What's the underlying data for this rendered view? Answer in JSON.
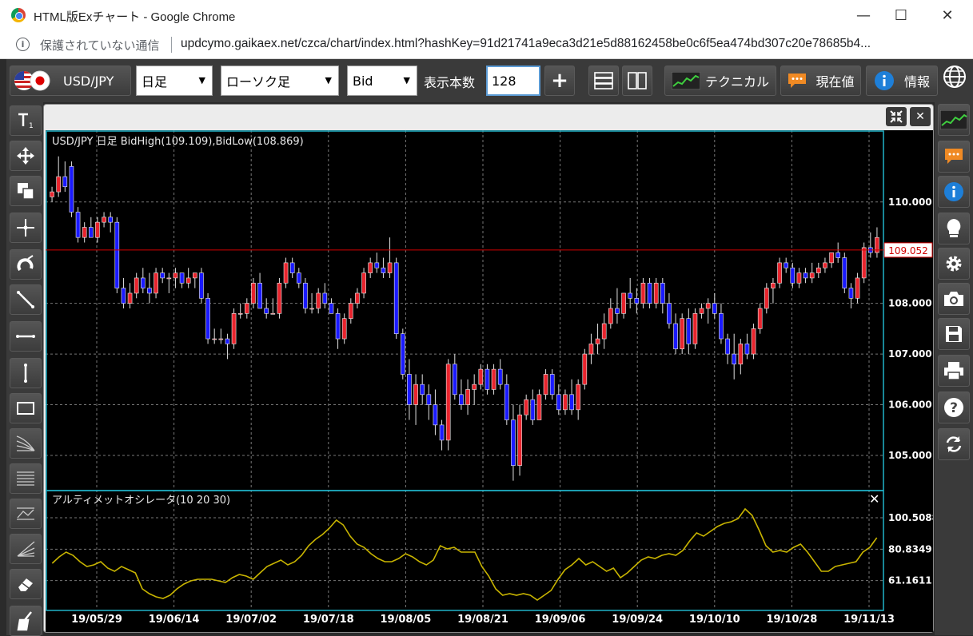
{
  "window": {
    "title": "HTML版Exチャート - Google Chrome",
    "minimize": "—",
    "maximize": "☐",
    "close": "✕"
  },
  "address": {
    "security": "保護されていない通信",
    "url": "updcymo.gaikaex.net/czca/chart/index.html?hashKey=91d21741a9eca3d21e5d88162458be0c6f5ea474bd307c20e78685b4..."
  },
  "toolbar": {
    "pair": "USD/JPY",
    "period": "日足",
    "chart_type": "ローソク足",
    "price_type": "Bid",
    "count_label": "表示本数",
    "count_value": "128",
    "plus": "+",
    "technical": "テクニカル",
    "current": "現在値",
    "info": "情報"
  },
  "colors": {
    "up": "#e8242d",
    "down": "#1a1aff",
    "oscillator": "#c8b400",
    "price_line": "#d00000",
    "frame": "#20b2c8"
  },
  "chart_data": [
    {
      "type": "candlestick",
      "title": "USD/JPY 日足  BidHigh(109.109),BidLow(108.869)",
      "current_price": "109.052",
      "current_value": 109.052,
      "yticks": [
        "110.000",
        "108.000",
        "107.000",
        "106.000",
        "105.000"
      ],
      "ytick_values": [
        110,
        108,
        107,
        106,
        105
      ],
      "ylim": [
        104.4,
        111.1
      ],
      "xticks": [
        "19/05/29",
        "19/06/14",
        "19/07/02",
        "19/07/18",
        "19/08/05",
        "19/08/21",
        "19/09/06",
        "19/09/24",
        "19/10/10",
        "19/10/28",
        "19/11/13"
      ],
      "grid": true,
      "ohlc": [
        [
          110.1,
          110.3,
          110.0,
          110.2
        ],
        [
          110.2,
          110.9,
          110.1,
          110.5
        ],
        [
          110.5,
          110.8,
          110.2,
          110.3
        ],
        [
          110.7,
          110.8,
          109.7,
          109.8
        ],
        [
          109.8,
          109.9,
          109.2,
          109.3
        ],
        [
          109.3,
          109.6,
          109.2,
          109.5
        ],
        [
          109.5,
          109.7,
          109.3,
          109.3
        ],
        [
          109.3,
          109.7,
          109.2,
          109.6
        ],
        [
          109.6,
          109.8,
          109.5,
          109.7
        ],
        [
          109.7,
          109.8,
          109.4,
          109.6
        ],
        [
          109.6,
          109.7,
          108.2,
          108.3
        ],
        [
          108.3,
          108.5,
          107.9,
          108.0
        ],
        [
          108.0,
          108.4,
          107.9,
          108.2
        ],
        [
          108.2,
          108.6,
          108.1,
          108.5
        ],
        [
          108.5,
          108.7,
          108.2,
          108.3
        ],
        [
          108.3,
          108.6,
          108.0,
          108.2
        ],
        [
          108.2,
          108.7,
          108.1,
          108.6
        ],
        [
          108.6,
          108.7,
          108.4,
          108.5
        ],
        [
          108.5,
          108.6,
          108.2,
          108.5
        ],
        [
          108.5,
          108.7,
          108.3,
          108.6
        ],
        [
          108.6,
          108.6,
          108.3,
          108.4
        ],
        [
          108.4,
          108.7,
          108.3,
          108.5
        ],
        [
          108.5,
          108.6,
          108.3,
          108.6
        ],
        [
          108.6,
          108.7,
          108.0,
          108.1
        ],
        [
          108.1,
          108.2,
          107.2,
          107.3
        ],
        [
          107.3,
          107.5,
          107.2,
          107.3
        ],
        [
          107.3,
          107.5,
          107.2,
          107.3
        ],
        [
          107.3,
          107.4,
          106.9,
          107.2
        ],
        [
          107.2,
          107.9,
          107.1,
          107.8
        ],
        [
          107.8,
          108.0,
          107.7,
          107.8
        ],
        [
          107.8,
          108.1,
          107.7,
          108.0
        ],
        [
          108.0,
          108.5,
          107.9,
          108.4
        ],
        [
          108.4,
          108.6,
          107.9,
          107.9
        ],
        [
          107.9,
          108.1,
          107.7,
          107.8
        ],
        [
          107.8,
          108.1,
          107.8,
          107.8
        ],
        [
          107.8,
          108.5,
          107.7,
          108.4
        ],
        [
          108.4,
          108.9,
          108.3,
          108.8
        ],
        [
          108.8,
          108.9,
          108.5,
          108.6
        ],
        [
          108.6,
          108.7,
          108.3,
          108.4
        ],
        [
          108.4,
          108.5,
          107.8,
          107.9
        ],
        [
          107.9,
          108.2,
          107.8,
          107.9
        ],
        [
          107.9,
          108.3,
          107.8,
          108.2
        ],
        [
          108.2,
          108.4,
          107.9,
          108.0
        ],
        [
          108.0,
          108.1,
          107.8,
          107.8
        ],
        [
          107.8,
          107.9,
          107.1,
          107.3
        ],
        [
          107.3,
          107.8,
          107.2,
          107.7
        ],
        [
          107.7,
          108.1,
          107.6,
          108.0
        ],
        [
          108.0,
          108.3,
          107.9,
          108.2
        ],
        [
          108.2,
          108.7,
          108.1,
          108.6
        ],
        [
          108.6,
          108.9,
          108.5,
          108.8
        ],
        [
          108.8,
          109.0,
          108.6,
          108.7
        ],
        [
          108.7,
          108.9,
          108.5,
          108.6
        ],
        [
          108.6,
          109.3,
          108.5,
          108.8
        ],
        [
          108.8,
          108.9,
          107.3,
          107.4
        ],
        [
          107.4,
          107.5,
          106.5,
          106.6
        ],
        [
          106.6,
          106.9,
          105.7,
          106.0
        ],
        [
          106.0,
          106.6,
          105.6,
          106.4
        ],
        [
          106.4,
          106.6,
          106.0,
          106.2
        ],
        [
          106.2,
          106.4,
          105.7,
          106.0
        ],
        [
          106.0,
          106.3,
          105.4,
          105.6
        ],
        [
          105.6,
          105.7,
          105.1,
          105.3
        ],
        [
          105.3,
          106.9,
          105.1,
          106.8
        ],
        [
          106.8,
          107.0,
          106.1,
          106.2
        ],
        [
          106.2,
          106.5,
          105.9,
          106.0
        ],
        [
          106.0,
          106.5,
          105.8,
          106.3
        ],
        [
          106.3,
          106.6,
          106.0,
          106.4
        ],
        [
          106.4,
          106.8,
          106.3,
          106.7
        ],
        [
          106.7,
          106.8,
          106.2,
          106.3
        ],
        [
          106.3,
          106.8,
          106.2,
          106.7
        ],
        [
          106.7,
          106.9,
          106.3,
          106.4
        ],
        [
          106.4,
          106.6,
          105.6,
          105.7
        ],
        [
          105.7,
          106.0,
          104.5,
          104.8
        ],
        [
          104.8,
          106.0,
          104.6,
          105.8
        ],
        [
          105.8,
          106.2,
          105.7,
          106.1
        ],
        [
          106.1,
          106.3,
          105.6,
          105.7
        ],
        [
          105.7,
          106.3,
          105.7,
          106.2
        ],
        [
          106.2,
          106.7,
          106.1,
          106.6
        ],
        [
          106.6,
          106.7,
          106.1,
          106.2
        ],
        [
          106.2,
          106.4,
          105.8,
          105.9
        ],
        [
          105.9,
          106.3,
          105.8,
          106.2
        ],
        [
          106.2,
          106.5,
          105.8,
          105.9
        ],
        [
          105.9,
          106.5,
          105.7,
          106.4
        ],
        [
          106.4,
          107.1,
          106.3,
          107.0
        ],
        [
          107.0,
          107.4,
          106.8,
          107.2
        ],
        [
          107.2,
          107.6,
          107.0,
          107.3
        ],
        [
          107.3,
          107.8,
          107.1,
          107.6
        ],
        [
          107.6,
          108.1,
          107.5,
          107.9
        ],
        [
          107.9,
          108.3,
          107.6,
          107.8
        ],
        [
          107.8,
          108.2,
          107.7,
          108.2
        ],
        [
          108.2,
          108.5,
          107.9,
          108.1
        ],
        [
          108.1,
          108.3,
          107.8,
          108.0
        ],
        [
          108.0,
          108.5,
          107.9,
          108.4
        ],
        [
          108.4,
          108.5,
          107.9,
          108.0
        ],
        [
          108.0,
          108.5,
          107.9,
          108.4
        ],
        [
          108.4,
          108.5,
          107.8,
          108.0
        ],
        [
          108.0,
          108.2,
          107.5,
          107.6
        ],
        [
          107.6,
          107.8,
          107.0,
          107.1
        ],
        [
          107.1,
          107.8,
          107.0,
          107.7
        ],
        [
          107.7,
          107.9,
          107.0,
          107.2
        ],
        [
          107.2,
          107.9,
          107.1,
          107.8
        ],
        [
          107.8,
          108.0,
          107.7,
          107.9
        ],
        [
          107.9,
          108.1,
          107.6,
          108.0
        ],
        [
          108.0,
          108.2,
          107.7,
          107.8
        ],
        [
          107.8,
          108.0,
          107.2,
          107.3
        ],
        [
          107.3,
          107.4,
          106.8,
          107.0
        ],
        [
          107.0,
          107.4,
          106.5,
          106.8
        ],
        [
          106.8,
          107.3,
          106.6,
          107.2
        ],
        [
          107.2,
          107.4,
          106.9,
          107.0
        ],
        [
          107.0,
          107.6,
          106.9,
          107.5
        ],
        [
          107.5,
          108.0,
          107.4,
          107.9
        ],
        [
          107.9,
          108.4,
          107.8,
          108.3
        ],
        [
          108.3,
          108.5,
          108.0,
          108.4
        ],
        [
          108.4,
          108.9,
          108.3,
          108.8
        ],
        [
          108.8,
          108.9,
          108.6,
          108.7
        ],
        [
          108.7,
          108.8,
          108.3,
          108.4
        ],
        [
          108.4,
          108.7,
          108.3,
          108.6
        ],
        [
          108.6,
          108.7,
          108.4,
          108.5
        ],
        [
          108.5,
          108.8,
          108.4,
          108.6
        ],
        [
          108.6,
          108.8,
          108.5,
          108.7
        ],
        [
          108.7,
          108.9,
          108.6,
          108.8
        ],
        [
          108.8,
          109.0,
          108.7,
          109.0
        ],
        [
          109.0,
          109.2,
          108.8,
          108.9
        ],
        [
          108.9,
          109.0,
          108.2,
          108.3
        ],
        [
          108.3,
          108.4,
          107.9,
          108.1
        ],
        [
          108.1,
          108.6,
          108.0,
          108.5
        ],
        [
          108.5,
          109.2,
          108.4,
          109.1
        ],
        [
          109.1,
          109.4,
          108.9,
          109.0
        ],
        [
          109.0,
          109.5,
          108.9,
          109.3
        ]
      ]
    },
    {
      "type": "line",
      "title": "アルティメットオシレータ(10 20 30)",
      "yticks": [
        "100.5088",
        "80.8349",
        "61.1611"
      ],
      "ytick_values": [
        100.5088,
        80.8349,
        61.1611
      ],
      "ylim": [
        44,
        108
      ],
      "grid": true,
      "values": [
        72,
        76,
        79,
        77,
        73,
        70,
        71,
        73,
        69,
        67,
        70,
        68,
        66,
        56,
        53,
        51,
        50,
        52,
        56,
        59,
        61,
        62,
        62,
        62,
        61,
        60,
        63,
        65,
        64,
        62,
        66,
        70,
        72,
        74,
        71,
        73,
        77,
        83,
        87,
        90,
        94,
        99,
        96,
        89,
        84,
        82,
        78,
        75,
        73,
        73,
        75,
        78,
        76,
        73,
        71,
        74,
        83,
        81,
        82,
        79,
        79,
        79,
        70,
        64,
        56,
        52,
        53,
        52,
        53,
        52,
        49,
        52,
        55,
        62,
        68,
        71,
        75,
        71,
        73,
        70,
        67,
        69,
        63,
        66,
        70,
        74,
        76,
        75,
        77,
        78,
        77,
        80,
        86,
        91,
        89,
        92,
        95,
        97,
        98,
        100,
        106,
        102,
        93,
        83,
        79,
        80,
        79,
        82,
        84,
        79,
        73,
        67,
        67,
        70,
        71,
        72,
        73,
        79,
        82,
        88
      ]
    }
  ]
}
